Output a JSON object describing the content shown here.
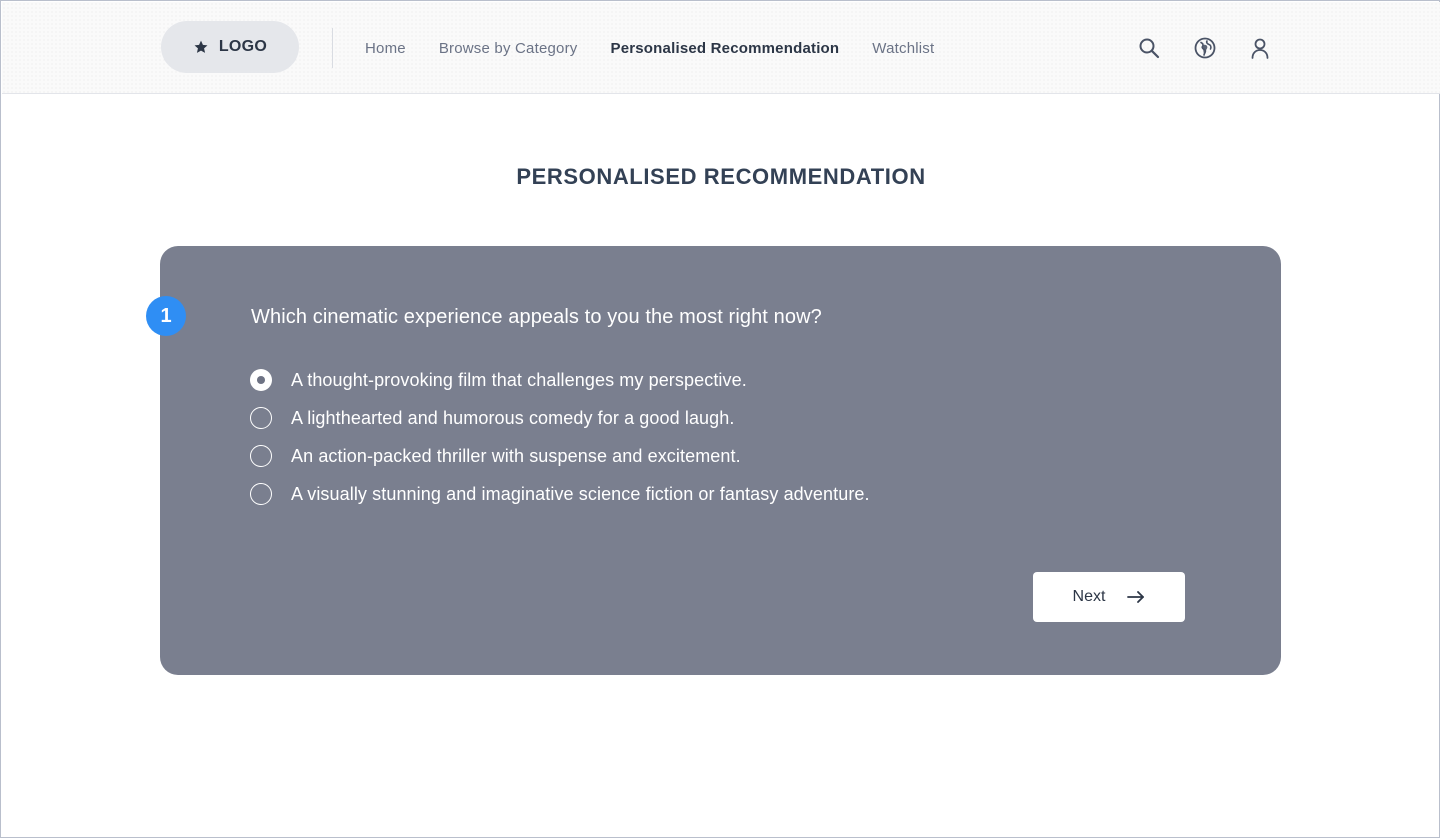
{
  "header": {
    "logo_text": "LOGO",
    "logo_icon": "star-icon",
    "nav": [
      {
        "label": "Home",
        "active": false
      },
      {
        "label": "Browse by Category",
        "active": false
      },
      {
        "label": "Personalised Recommendation",
        "active": true
      },
      {
        "label": "Watchlist",
        "active": false
      }
    ],
    "icons": [
      "search-icon",
      "globe-icon",
      "user-icon"
    ]
  },
  "main": {
    "title": "PERSONALISED RECOMMENDATION",
    "step": "1",
    "question": "Which cinematic experience appeals to you the most right now?",
    "options": [
      {
        "label": "A thought-provoking film that challenges my perspective.",
        "selected": true
      },
      {
        "label": "A lighthearted and humorous comedy for a good laugh.",
        "selected": false
      },
      {
        "label": "An action-packed thriller with suspense and excitement.",
        "selected": false
      },
      {
        "label": "A visually stunning and imaginative science fiction or fantasy adventure.",
        "selected": false
      }
    ],
    "next_label": "Next",
    "next_icon": "arrow-right-icon"
  },
  "colors": {
    "card_bg": "#7a7f8f",
    "badge_bg": "#2f8ef4",
    "text_dark": "#2c3646",
    "nav_muted": "#6b7386"
  }
}
